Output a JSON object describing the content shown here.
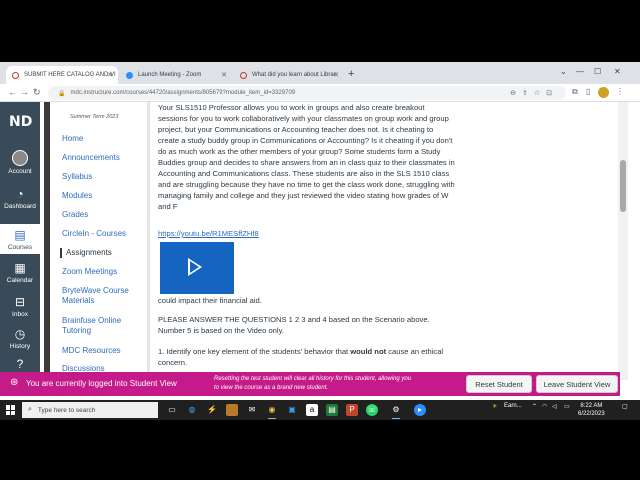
{
  "browser": {
    "tabs": [
      {
        "title": "SUBMIT HERE CATALOG AND VI"
      },
      {
        "title": "Launch Meeting - Zoom"
      },
      {
        "title": "What did you learn about Librar"
      }
    ],
    "url": "mdc.instructure.com/courses/44720/assignments/805679?module_item_id=3329709"
  },
  "global_nav": {
    "items": [
      {
        "label": "Account"
      },
      {
        "label": "Dashboard"
      },
      {
        "label": "Courses"
      },
      {
        "label": "Calendar"
      },
      {
        "label": "Inbox"
      },
      {
        "label": "History"
      }
    ]
  },
  "course_nav": {
    "term": "Summer Term 2023",
    "items": [
      {
        "label": "Home"
      },
      {
        "label": "Announcements"
      },
      {
        "label": "Syllabus"
      },
      {
        "label": "Modules"
      },
      {
        "label": "Grades"
      },
      {
        "label": "CircleIn - Courses"
      },
      {
        "label": "Assignments"
      },
      {
        "label": "Zoom Meetings"
      },
      {
        "label": "BryteWave Course Materials"
      },
      {
        "label": "Brainfuse Online Tutoring"
      },
      {
        "label": "MDC Resources"
      },
      {
        "label": "Discussions"
      }
    ]
  },
  "content": {
    "scenario": "Your SLS1510 Professor allows you to work in groups and  also create breakout sessions for you to work collaboratively with your classmates on group work and group project, but your Communications or Accounting  teacher does not. Is it cheating to create a study buddy group in Communications or Accounting? Is it cheating if you don't do as much work as the other members of your group? Some students form a Study Buddies group and decides to share answers from an in class quiz to their classmates in Accounting and Communications class. These students are also in the SLS 1510 class and are struggling because they have no time to get the class work done, struggling with managing family and college and they just reviewed the video stating how grades of W and F",
    "video_link": "https://youtu.be/R1MESffZHf8",
    "after_video": "could impact their financial aid.",
    "instructions": "PLEASE ANSWER THE QUESTIONS 1 2  3 and 4 based on the Scenario above. Number 5 is based on the Video only.",
    "q1_prefix": "1. Identify one key element of the students' behavior that ",
    "q1_bold": "would not",
    "q1_suffix": " cause an ethical concern."
  },
  "student_view": {
    "message": "You are currently logged into Student View",
    "note": "Resetting the test student will clear all history for this student, allowing you to view the course as a brand new student.",
    "reset_label": "Reset Student",
    "leave_label": "Leave Student View"
  },
  "taskbar": {
    "search_placeholder": "Type here to search",
    "weather": "Earn...",
    "time": "8:22 AM",
    "date": "6/22/2023"
  }
}
